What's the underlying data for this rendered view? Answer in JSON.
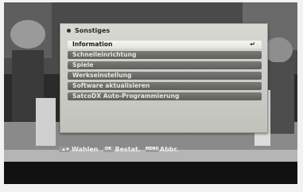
{
  "menu": {
    "title": "Sonstiges",
    "items": [
      {
        "label": "Information",
        "selected": true
      },
      {
        "label": "Schnelleinrichtung",
        "selected": false
      },
      {
        "label": "Spiele",
        "selected": false
      },
      {
        "label": "Werkseinstellung",
        "selected": false
      },
      {
        "label": "Software aktualisieren",
        "selected": false
      },
      {
        "label": "SatcoDX Auto-Programmierung",
        "selected": false
      }
    ],
    "enter_icon": "↵"
  },
  "help_bar": {
    "select_key_icon": "up-down-arrows-icon",
    "select_label": "Wahlen",
    "ok_key": "OK",
    "ok_label": "Bestat.",
    "menu_key": "MENU",
    "menu_label": "Abbr."
  },
  "colors": {
    "panel": "#cfcfc9",
    "item": "#6e6e6a",
    "selected_item": "#f0f0ec"
  }
}
